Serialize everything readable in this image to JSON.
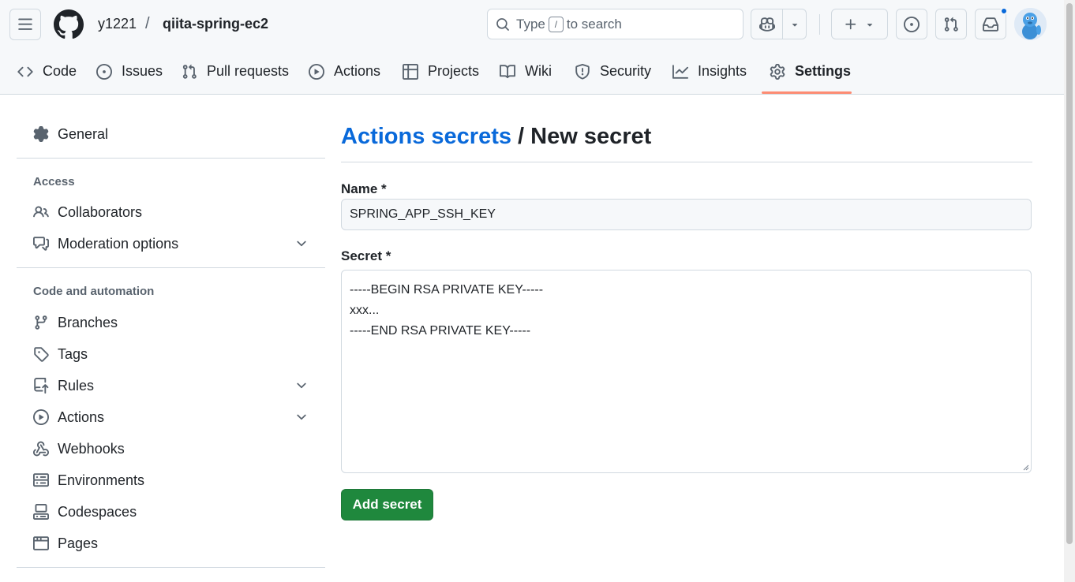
{
  "header": {
    "owner": "y1221",
    "separator": "/",
    "repo": "qiita-spring-ec2",
    "search": {
      "before": "Type",
      "key": "/",
      "after": "to search"
    }
  },
  "nav": {
    "tabs": [
      {
        "label": "Code",
        "icon": "code-icon",
        "active": false
      },
      {
        "label": "Issues",
        "icon": "issue-opened-icon",
        "active": false
      },
      {
        "label": "Pull requests",
        "icon": "git-pull-request-icon",
        "active": false
      },
      {
        "label": "Actions",
        "icon": "play-icon",
        "active": false
      },
      {
        "label": "Projects",
        "icon": "table-icon",
        "active": false
      },
      {
        "label": "Wiki",
        "icon": "book-icon",
        "active": false
      },
      {
        "label": "Security",
        "icon": "shield-icon",
        "active": false
      },
      {
        "label": "Insights",
        "icon": "graph-icon",
        "active": false
      },
      {
        "label": "Settings",
        "icon": "gear-icon",
        "active": true
      }
    ]
  },
  "sidebar": {
    "general": "General",
    "access_heading": "Access",
    "access_items": [
      {
        "label": "Collaborators",
        "icon": "people-icon",
        "expandable": false
      },
      {
        "label": "Moderation options",
        "icon": "comment-discussion-icon",
        "expandable": true
      }
    ],
    "automation_heading": "Code and automation",
    "automation_items": [
      {
        "label": "Branches",
        "icon": "git-branch-icon",
        "expandable": false
      },
      {
        "label": "Tags",
        "icon": "tag-icon",
        "expandable": false
      },
      {
        "label": "Rules",
        "icon": "repo-push-icon",
        "expandable": true
      },
      {
        "label": "Actions",
        "icon": "play-icon",
        "expandable": true
      },
      {
        "label": "Webhooks",
        "icon": "webhook-icon",
        "expandable": false
      },
      {
        "label": "Environments",
        "icon": "server-icon",
        "expandable": false
      },
      {
        "label": "Codespaces",
        "icon": "codespaces-icon",
        "expandable": false
      },
      {
        "label": "Pages",
        "icon": "browser-icon",
        "expandable": false
      }
    ]
  },
  "main": {
    "breadcrumb_link": "Actions secrets",
    "breadcrumb_sep": " / ",
    "title": "New secret",
    "name_label": "Name *",
    "name_value": "SPRING_APP_SSH_KEY",
    "secret_label": "Secret *",
    "secret_value": "-----BEGIN RSA PRIVATE KEY-----\nxxx...\n-----END RSA PRIVATE KEY-----",
    "submit_label": "Add secret"
  },
  "colors": {
    "accent": "#0969da",
    "primary_button": "#1f883d",
    "active_tab_underline": "#fd8c73",
    "header_bg": "#f6f8fa",
    "notification_dot": "#0969da"
  }
}
